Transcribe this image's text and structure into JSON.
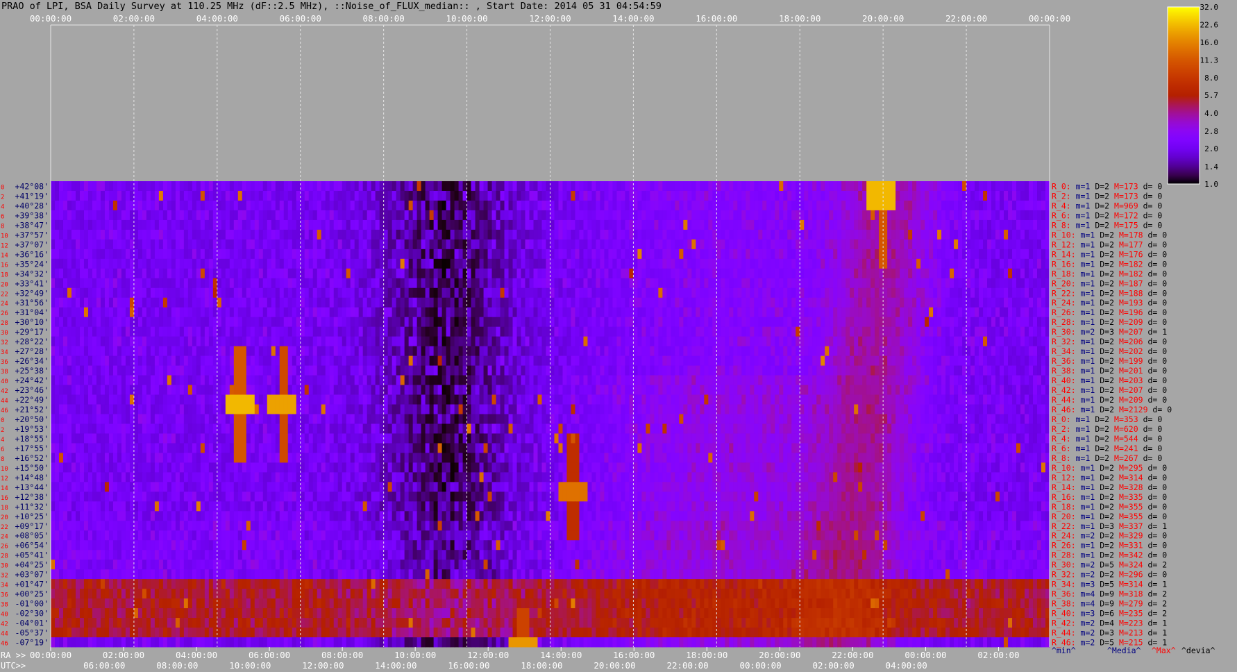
{
  "title": "PRAO of LPI, BSA Daily Survey at 110.25 MHz (dF::2.5 MHz), ::Noise_of_FLUX_median:: , Start Date: 2014 05 31 04:54:59",
  "colors": {
    "background": "#a6a6a6",
    "grid": "#e6e6e6",
    "dec_label": "#000066",
    "row_index": "#ff0000",
    "stat_R": "#ff0000",
    "stat_m": "#000080",
    "stat_D": "#000000",
    "stat_M": "#ff0000",
    "stat_d": "#000000"
  },
  "colorbar": {
    "colormap": "gnuplot",
    "scale": "log",
    "range": [
      1.0,
      32.0
    ],
    "ticks": [
      "32.0",
      "22.6",
      "16.0",
      "11.3",
      "8.0",
      "5.7",
      "4.0",
      "2.8",
      "2.0",
      "1.4",
      "1.0"
    ]
  },
  "bottom_labels": {
    "ra": "RA >>",
    "utc": "UTC>>",
    "min": "^min^",
    "median": "^Media^",
    "max": "^Max^",
    "devia": "^devia^"
  },
  "chart_data": {
    "type": "heatmap",
    "title": "PRAO of LPI, BSA Daily Survey at 110.25 MHz (dF::2.5 MHz), ::Noise_of_FLUX_median:: , Start Date: 2014 05 31 04:54:59",
    "x_top_ticks": [
      "00:00:00",
      "02:00:00",
      "04:00:00",
      "06:00:00",
      "08:00:00",
      "10:00:00",
      "12:00:00",
      "14:00:00",
      "16:00:00",
      "18:00:00",
      "20:00:00",
      "22:00:00",
      "00:00:00"
    ],
    "ra_ticks": [
      "00:00:00",
      "02:00:00",
      "04:00:00",
      "06:00:00",
      "08:00:00",
      "10:00:00",
      "12:00:00",
      "14:00:00",
      "16:00:00",
      "18:00:00",
      "20:00:00",
      "22:00:00",
      "00:00:00",
      "02:00:00",
      "04:00:00"
    ],
    "utc_ticks": [
      "06:00:00",
      "08:00:00",
      "10:00:00",
      "12:00:00",
      "14:00:00",
      "16:00:00",
      "18:00:00",
      "20:00:00",
      "22:00:00",
      "00:00:00",
      "02:00:00",
      "04:00:00"
    ],
    "rows": [
      {
        "idx": "0",
        "dec": "+42°08'",
        "stat": {
          "R": "R_0:",
          "m": "m=1",
          "D": "D=2",
          "M": "M=173",
          "d": "d= 0"
        }
      },
      {
        "idx": "2",
        "dec": "+41°19'",
        "stat": {
          "R": "R_2:",
          "m": "m=1",
          "D": "D=2",
          "M": "M=173",
          "d": "d= 0"
        }
      },
      {
        "idx": "4",
        "dec": "+40°28'",
        "stat": {
          "R": "R_4:",
          "m": "m=1",
          "D": "D=2",
          "M": "M=969",
          "d": "d= 0"
        }
      },
      {
        "idx": "6",
        "dec": "+39°38'",
        "stat": {
          "R": "R_6:",
          "m": "m=1",
          "D": "D=2",
          "M": "M=172",
          "d": "d= 0"
        }
      },
      {
        "idx": "8",
        "dec": "+38°47'",
        "stat": {
          "R": "R_8:",
          "m": "m=1",
          "D": "D=2",
          "M": "M=175",
          "d": "d= 0"
        }
      },
      {
        "idx": "10",
        "dec": "+37°57'",
        "stat": {
          "R": "R_10:",
          "m": "m=1",
          "D": "D=2",
          "M": "M=178",
          "d": "d= 0"
        }
      },
      {
        "idx": "12",
        "dec": "+37°07'",
        "stat": {
          "R": "R_12:",
          "m": "m=1",
          "D": "D=2",
          "M": "M=177",
          "d": "d= 0"
        }
      },
      {
        "idx": "14",
        "dec": "+36°16'",
        "stat": {
          "R": "R_14:",
          "m": "m=1",
          "D": "D=2",
          "M": "M=176",
          "d": "d= 0"
        }
      },
      {
        "idx": "16",
        "dec": "+35°24'",
        "stat": {
          "R": "R_16:",
          "m": "m=1",
          "D": "D=2",
          "M": "M=182",
          "d": "d= 0"
        }
      },
      {
        "idx": "18",
        "dec": "+34°32'",
        "stat": {
          "R": "R_18:",
          "m": "m=1",
          "D": "D=2",
          "M": "M=182",
          "d": "d= 0"
        }
      },
      {
        "idx": "20",
        "dec": "+33°41'",
        "stat": {
          "R": "R_20:",
          "m": "m=1",
          "D": "D=2",
          "M": "M=187",
          "d": "d= 0"
        }
      },
      {
        "idx": "22",
        "dec": "+32°49'",
        "stat": {
          "R": "R_22:",
          "m": "m=1",
          "D": "D=2",
          "M": "M=188",
          "d": "d= 0"
        }
      },
      {
        "idx": "24",
        "dec": "+31°56'",
        "stat": {
          "R": "R_24:",
          "m": "m=1",
          "D": "D=2",
          "M": "M=193",
          "d": "d= 0"
        }
      },
      {
        "idx": "26",
        "dec": "+31°04'",
        "stat": {
          "R": "R_26:",
          "m": "m=1",
          "D": "D=2",
          "M": "M=196",
          "d": "d= 0"
        }
      },
      {
        "idx": "28",
        "dec": "+30°10'",
        "stat": {
          "R": "R_28:",
          "m": "m=1",
          "D": "D=2",
          "M": "M=209",
          "d": "d= 0"
        }
      },
      {
        "idx": "30",
        "dec": "+29°17'",
        "stat": {
          "R": "R_30:",
          "m": "m=2",
          "D": "D=3",
          "M": "M=207",
          "d": "d= 1"
        }
      },
      {
        "idx": "32",
        "dec": "+28°22'",
        "stat": {
          "R": "R_32:",
          "m": "m=1",
          "D": "D=2",
          "M": "M=206",
          "d": "d= 0"
        }
      },
      {
        "idx": "34",
        "dec": "+27°28'",
        "stat": {
          "R": "R_34:",
          "m": "m=1",
          "D": "D=2",
          "M": "M=202",
          "d": "d= 0"
        }
      },
      {
        "idx": "36",
        "dec": "+26°34'",
        "stat": {
          "R": "R_36:",
          "m": "m=1",
          "D": "D=2",
          "M": "M=199",
          "d": "d= 0"
        }
      },
      {
        "idx": "38",
        "dec": "+25°38'",
        "stat": {
          "R": "R_38:",
          "m": "m=1",
          "D": "D=2",
          "M": "M=201",
          "d": "d= 0"
        }
      },
      {
        "idx": "40",
        "dec": "+24°42'",
        "stat": {
          "R": "R_40:",
          "m": "m=1",
          "D": "D=2",
          "M": "M=203",
          "d": "d= 0"
        }
      },
      {
        "idx": "42",
        "dec": "+23°46'",
        "stat": {
          "R": "R_42:",
          "m": "m=1",
          "D": "D=2",
          "M": "M=207",
          "d": "d= 0"
        }
      },
      {
        "idx": "44",
        "dec": "+22°49'",
        "stat": {
          "R": "R_44:",
          "m": "m=1",
          "D": "D=2",
          "M": "M=209",
          "d": "d= 0"
        }
      },
      {
        "idx": "46",
        "dec": "+21°52'",
        "stat": {
          "R": "R_46:",
          "m": "m=1",
          "D": "D=2",
          "M": "M=2129",
          "d": "d= 0"
        }
      },
      {
        "idx": "0",
        "dec": "+20°50'",
        "stat": {
          "R": "R_0:",
          "m": "m=1",
          "D": "D=2",
          "M": "M=353",
          "d": "d= 0"
        }
      },
      {
        "idx": "2",
        "dec": "+19°53'",
        "stat": {
          "R": "R_2:",
          "m": "m=1",
          "D": "D=2",
          "M": "M=620",
          "d": "d= 0"
        }
      },
      {
        "idx": "4",
        "dec": "+18°55'",
        "stat": {
          "R": "R_4:",
          "m": "m=1",
          "D": "D=2",
          "M": "M=544",
          "d": "d= 0"
        }
      },
      {
        "idx": "6",
        "dec": "+17°55'",
        "stat": {
          "R": "R_6:",
          "m": "m=1",
          "D": "D=2",
          "M": "M=241",
          "d": "d= 0"
        }
      },
      {
        "idx": "8",
        "dec": "+16°52'",
        "stat": {
          "R": "R_8:",
          "m": "m=1",
          "D": "D=2",
          "M": "M=267",
          "d": "d= 0"
        }
      },
      {
        "idx": "10",
        "dec": "+15°50'",
        "stat": {
          "R": "R_10:",
          "m": "m=1",
          "D": "D=2",
          "M": "M=295",
          "d": "d= 0"
        }
      },
      {
        "idx": "12",
        "dec": "+14°48'",
        "stat": {
          "R": "R_12:",
          "m": "m=1",
          "D": "D=2",
          "M": "M=314",
          "d": "d= 0"
        }
      },
      {
        "idx": "14",
        "dec": "+13°44'",
        "stat": {
          "R": "R_14:",
          "m": "m=1",
          "D": "D=2",
          "M": "M=328",
          "d": "d= 0"
        }
      },
      {
        "idx": "16",
        "dec": "+12°38'",
        "stat": {
          "R": "R_16:",
          "m": "m=1",
          "D": "D=2",
          "M": "M=335",
          "d": "d= 0"
        }
      },
      {
        "idx": "18",
        "dec": "+11°32'",
        "stat": {
          "R": "R_18:",
          "m": "m=1",
          "D": "D=2",
          "M": "M=355",
          "d": "d= 0"
        }
      },
      {
        "idx": "20",
        "dec": "+10°25'",
        "stat": {
          "R": "R_20:",
          "m": "m=1",
          "D": "D=2",
          "M": "M=355",
          "d": "d= 0"
        }
      },
      {
        "idx": "22",
        "dec": "+09°17'",
        "stat": {
          "R": "R_22:",
          "m": "m=1",
          "D": "D=3",
          "M": "M=337",
          "d": "d= 1"
        }
      },
      {
        "idx": "24",
        "dec": "+08°05'",
        "stat": {
          "R": "R_24:",
          "m": "m=2",
          "D": "D=2",
          "M": "M=329",
          "d": "d= 0"
        }
      },
      {
        "idx": "26",
        "dec": "+06°54'",
        "stat": {
          "R": "R_26:",
          "m": "m=1",
          "D": "D=2",
          "M": "M=331",
          "d": "d= 0"
        }
      },
      {
        "idx": "28",
        "dec": "+05°41'",
        "stat": {
          "R": "R_28:",
          "m": "m=1",
          "D": "D=2",
          "M": "M=342",
          "d": "d= 0"
        }
      },
      {
        "idx": "30",
        "dec": "+04°25'",
        "stat": {
          "R": "R_30:",
          "m": "m=2",
          "D": "D=5",
          "M": "M=324",
          "d": "d= 2"
        }
      },
      {
        "idx": "32",
        "dec": "+03°07'",
        "stat": {
          "R": "R_32:",
          "m": "m=2",
          "D": "D=2",
          "M": "M=296",
          "d": "d= 0"
        }
      },
      {
        "idx": "34",
        "dec": "+01°47'",
        "stat": {
          "R": "R_34:",
          "m": "m=3",
          "D": "D=5",
          "M": "M=314",
          "d": "d= 1"
        }
      },
      {
        "idx": "36",
        "dec": "+00°25'",
        "stat": {
          "R": "R_36:",
          "m": "m=4",
          "D": "D=9",
          "M": "M=318",
          "d": "d= 2"
        }
      },
      {
        "idx": "38",
        "dec": "-01°00'",
        "stat": {
          "R": "R_38:",
          "m": "m=4",
          "D": "D=9",
          "M": "M=279",
          "d": "d= 2"
        }
      },
      {
        "idx": "40",
        "dec": "-02°30'",
        "stat": {
          "R": "R_40:",
          "m": "m=3",
          "D": "D=6",
          "M": "M=235",
          "d": "d= 2"
        }
      },
      {
        "idx": "42",
        "dec": "-04°01'",
        "stat": {
          "R": "R_42:",
          "m": "m=2",
          "D": "D=4",
          "M": "M=223",
          "d": "d= 1"
        }
      },
      {
        "idx": "44",
        "dec": "-05°37'",
        "stat": {
          "R": "R_44:",
          "m": "m=2",
          "D": "D=3",
          "M": "M=213",
          "d": "d= 1"
        }
      },
      {
        "idx": "46",
        "dec": "-07°19'",
        "stat": {
          "R": "R_46:",
          "m": "m=2",
          "D": "D=5",
          "M": "M=215",
          "d": "d= 1"
        }
      }
    ],
    "bright_sources": [
      {
        "ra_hour": 4.5,
        "dec": 22.3,
        "level": 32
      },
      {
        "ra_hour": 5.55,
        "dec": 22.3,
        "level": 28
      },
      {
        "ra_hour": 19.95,
        "dec": 41.0,
        "level": 32
      },
      {
        "ra_hour": 12.5,
        "dec": 13.3,
        "level": 20
      },
      {
        "ra_hour": 11.3,
        "dec": -7.2,
        "level": 26
      }
    ]
  }
}
